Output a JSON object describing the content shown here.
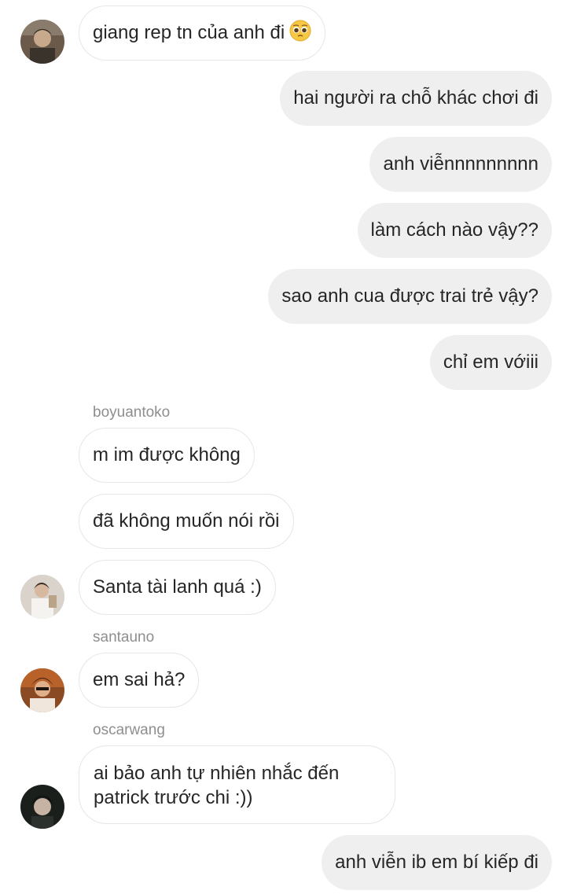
{
  "messages": [
    {
      "text": "giang rep tn của anh đi",
      "emoji": "pleading-face-emoji"
    },
    {
      "text": "hai người ra chỗ khác chơi đi"
    },
    {
      "text": "anh viễnnnnnnnnn"
    },
    {
      "text": "làm cách nào vậy??"
    },
    {
      "text": "sao anh cua được trai trẻ vậy?"
    },
    {
      "text": "chỉ em vớiii"
    },
    {
      "sender": "boyuantoko"
    },
    {
      "text": "m im được không"
    },
    {
      "text": "đã không muốn nói rồi"
    },
    {
      "text": "Santa tài lanh quá :)"
    },
    {
      "sender": "santauno"
    },
    {
      "text": "em sai hả?"
    },
    {
      "sender": "oscarwang"
    },
    {
      "text_line1": "ai bảo anh tự nhiên nhắc đến",
      "text_line2": "patrick trước chi :))"
    },
    {
      "text": "anh viễn ib em bí kiếp đi"
    }
  ],
  "colors": {
    "incoming_border": "#e6e6e6",
    "outgoing_bg": "#efefef",
    "sender": "#8e8e8e",
    "text": "#262626"
  }
}
